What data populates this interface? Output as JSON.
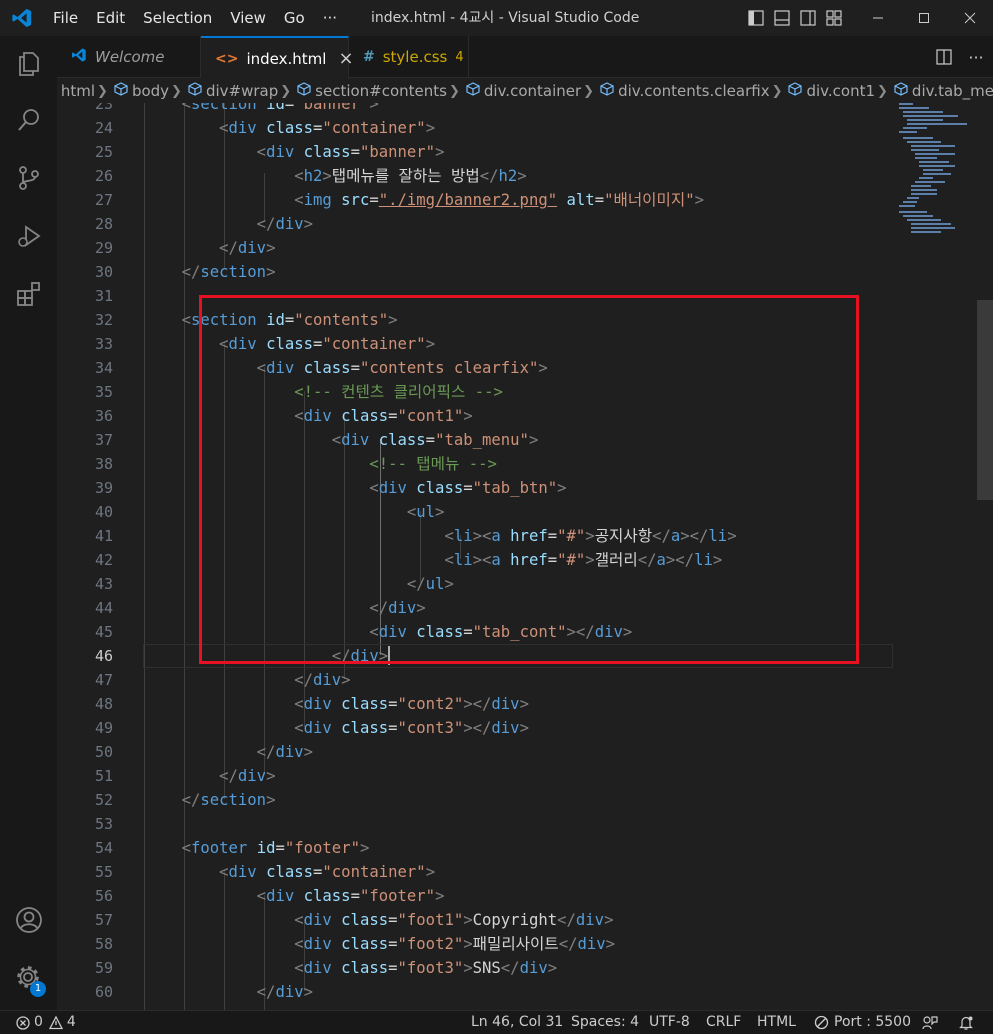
{
  "menu": [
    "File",
    "Edit",
    "Selection",
    "View",
    "Go"
  ],
  "menu_more": "···",
  "window_title": "index.html - 4교시 - Visual Studio Code",
  "tabs": [
    {
      "label": "Welcome",
      "icon": "vscode-logo-icon",
      "active": false
    },
    {
      "label": "index.html",
      "icon": "html-icon",
      "icon_glyph": "<>",
      "active": true,
      "close": "×"
    },
    {
      "label": "style.css",
      "icon": "css-icon",
      "icon_glyph": "#",
      "count": "4",
      "active": false
    }
  ],
  "tabs_more": "···",
  "breadcrumb": [
    "html",
    "body",
    "div#wrap",
    "section#contents",
    "div.container",
    "div.contents.clearfix",
    "div.cont1",
    "div.tab_menu"
  ],
  "code": {
    "lines": [
      23,
      24,
      25,
      26,
      27,
      28,
      29,
      30,
      31,
      32,
      33,
      34,
      35,
      36,
      37,
      38,
      39,
      40,
      41,
      42,
      43,
      44,
      45,
      46,
      47,
      48,
      49,
      50,
      51,
      52,
      53,
      54,
      55,
      56,
      57,
      58,
      59,
      60
    ],
    "current_line": 46,
    "text": {
      "l26": "탭메뉴를 잘하는 방법",
      "l27_src": "\"./img/banner2.png\"",
      "l27_alt": "\"배너이미지\"",
      "l35": "<!-- 컨텐츠 클리어픽스 -->",
      "l38": "<!-- 탭메뉴 -->",
      "l41": "공지사항",
      "l42": "갤러리",
      "l57": "Copyright",
      "l58": "패밀리사이트",
      "l59": "SNS"
    }
  },
  "colors": {
    "tag": "#569cd6",
    "attr": "#9cdcfe",
    "string": "#ce9178",
    "comment": "#6a9955",
    "highlight": "#e81123",
    "accent": "#0078d4"
  },
  "activity_bar": [
    {
      "name": "explorer-icon"
    },
    {
      "name": "search-icon"
    },
    {
      "name": "source-control-icon"
    },
    {
      "name": "run-debug-icon"
    },
    {
      "name": "extensions-icon"
    }
  ],
  "activity_bottom": {
    "accounts": "account-icon",
    "settings": "gear-icon",
    "settings_badge": "1"
  },
  "status": {
    "errors": "0",
    "warnings": "4",
    "position": "Ln 46, Col 31",
    "spaces": "Spaces: 4",
    "encoding": "UTF-8",
    "eol": "CRLF",
    "language": "HTML",
    "port": "Port : 5500"
  }
}
